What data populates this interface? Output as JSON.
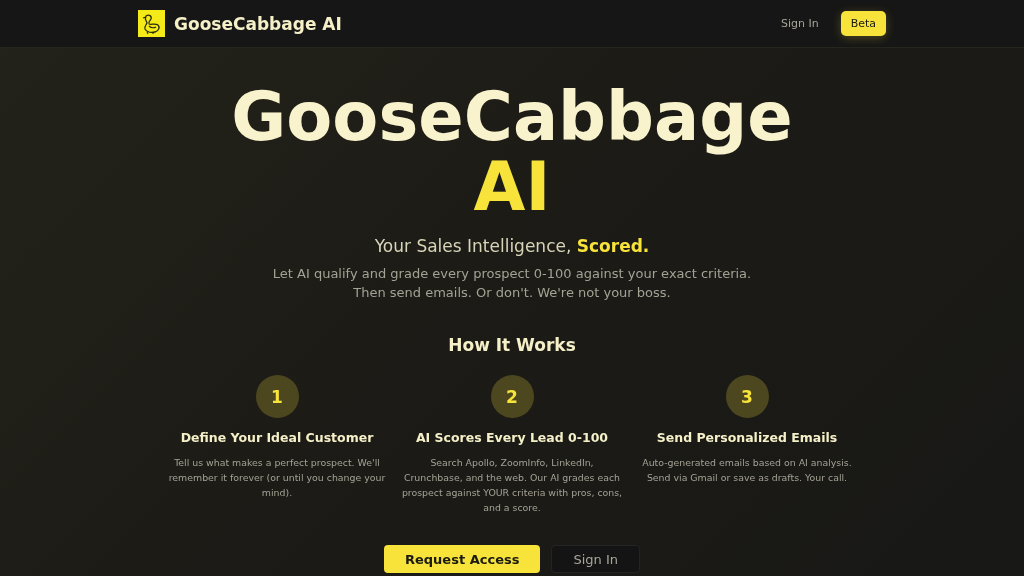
{
  "nav": {
    "brand": "GooseCabbage AI",
    "links": [
      {
        "label": "Sign In",
        "kind": "link"
      },
      {
        "label": "Beta",
        "kind": "badge"
      }
    ]
  },
  "hero": {
    "title": "GooseCabbage",
    "title_accent": "AI",
    "subtitle": "Your Sales Intelligence, **Scored.**",
    "lines": [
      "Let AI qualify and grade every prospect 0-100 against your exact criteria.",
      "Then send emails. Or don't. We're not your boss."
    ]
  },
  "how": {
    "heading": "How It Works",
    "steps": [
      {
        "number": "1",
        "title": "Define Your Ideal Customer",
        "text": "Tell us what makes a perfect prospect. We'll remember it forever (or until you change your mind)."
      },
      {
        "number": "2",
        "title": "AI Scores Every Lead 0-100",
        "text": "Search Apollo, ZoomInfo, LinkedIn, Crunchbase, and the web. Our AI grades each prospect against YOUR criteria with pros, cons, and a score."
      },
      {
        "number": "3",
        "title": "Send Personalized Emails",
        "text": "Auto-generated emails based on AI analysis. Send via Gmail or save as drafts. Your call."
      }
    ]
  },
  "actions": [
    {
      "label": "Request Access",
      "kind": "primary"
    },
    {
      "label": "Sign In",
      "kind": "secondary"
    }
  ]
}
